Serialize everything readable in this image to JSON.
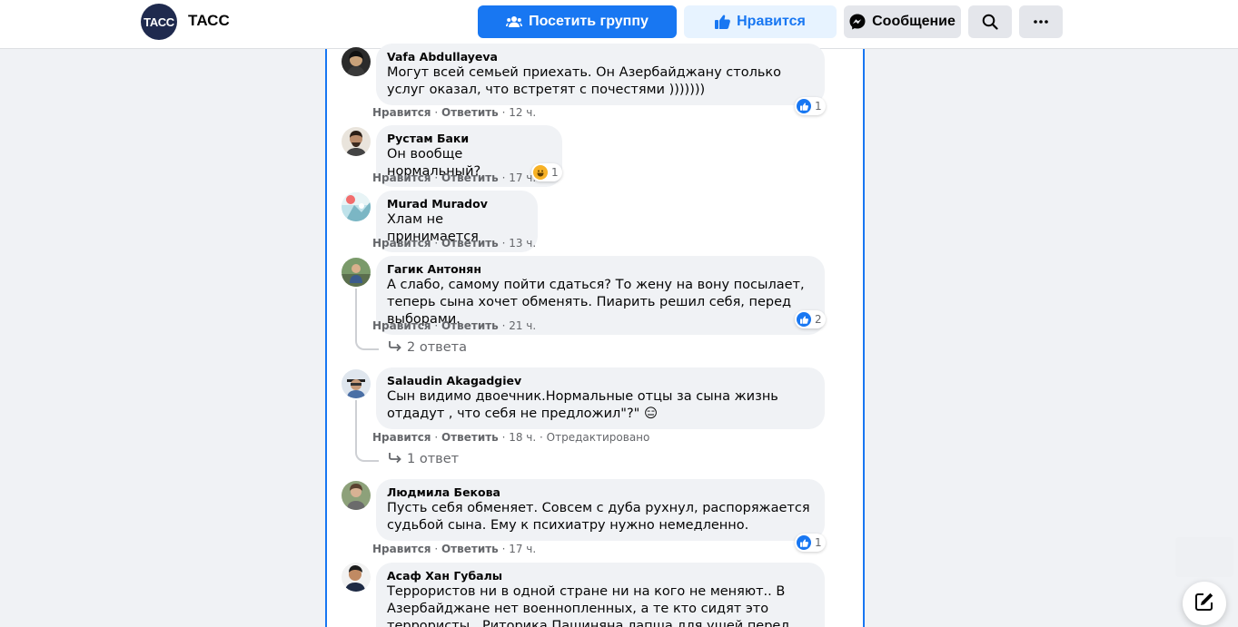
{
  "header": {
    "logo_text": "ТАСС",
    "page_name": "ТАСС",
    "visit_group_label": "Посетить группу",
    "like_label": "Нравится",
    "message_label": "Сообщение"
  },
  "comments": [
    {
      "author": "Vafa Abdullayeva",
      "text": "Могут всей семьей приехать. Он Азербайджану столько услуг оказал, что встретят с почестями )))))))",
      "like": "Нравится",
      "reply": "Ответить",
      "time": "12 ч.",
      "reaction_count": "1"
    },
    {
      "author": "Рустам Баки",
      "text": "Он вообще нормальный?",
      "like": "Нравится",
      "reply": "Ответить",
      "time": "17 ч.",
      "reaction_count": "1"
    },
    {
      "author": "Murad Muradov",
      "text": "Хлам не принимается",
      "like": "Нравится",
      "reply": "Ответить",
      "time": "13 ч."
    },
    {
      "author": "Гагик Антонян",
      "text": "А слабо, самому пойти сдаться? То жену на вону посылает, теперь сына хочет обменять. Пиарить решил себя, перед выборами.",
      "like": "Нравится",
      "reply": "Ответить",
      "time": "21 ч.",
      "reaction_count": "2",
      "replies_label": "2 ответа"
    },
    {
      "author": "Salaudin Akagadgiev",
      "text": "Сын видимо двоечник.Нормальные отцы за сына жизнь отдадут , что себя не предложил\"?\"",
      "emoji": "😑",
      "like": "Нравится",
      "reply": "Ответить",
      "time": "18 ч.",
      "edited": "Отредактировано",
      "replies_label": "1 ответ"
    },
    {
      "author": "Людмила Бекова",
      "text": "Пусть себя обменяет. Совсем с дуба рухнул, распоряжается судьбой сына. Ему к психиатру нужно немедленно.",
      "like": "Нравится",
      "reply": "Ответить",
      "time": "17 ч.",
      "reaction_count": "1"
    },
    {
      "author": "Асаф Хан Губалы",
      "text": "Террористов ни в одной стране ни на кого не меняют.. В Азербайджане нет военнопленных, а те кто сидят это террористы.. Риторика Пашиняна лапша для ушей перед началом"
    }
  ],
  "colors": {
    "accent": "#1877f2",
    "bubble": "#f0f2f5",
    "secondary_text": "#65676b"
  },
  "icons": [
    "group-icon",
    "thumbs-up-icon",
    "messenger-icon",
    "search-icon",
    "more-icon",
    "reply-arrow-icon",
    "new-message-icon"
  ]
}
